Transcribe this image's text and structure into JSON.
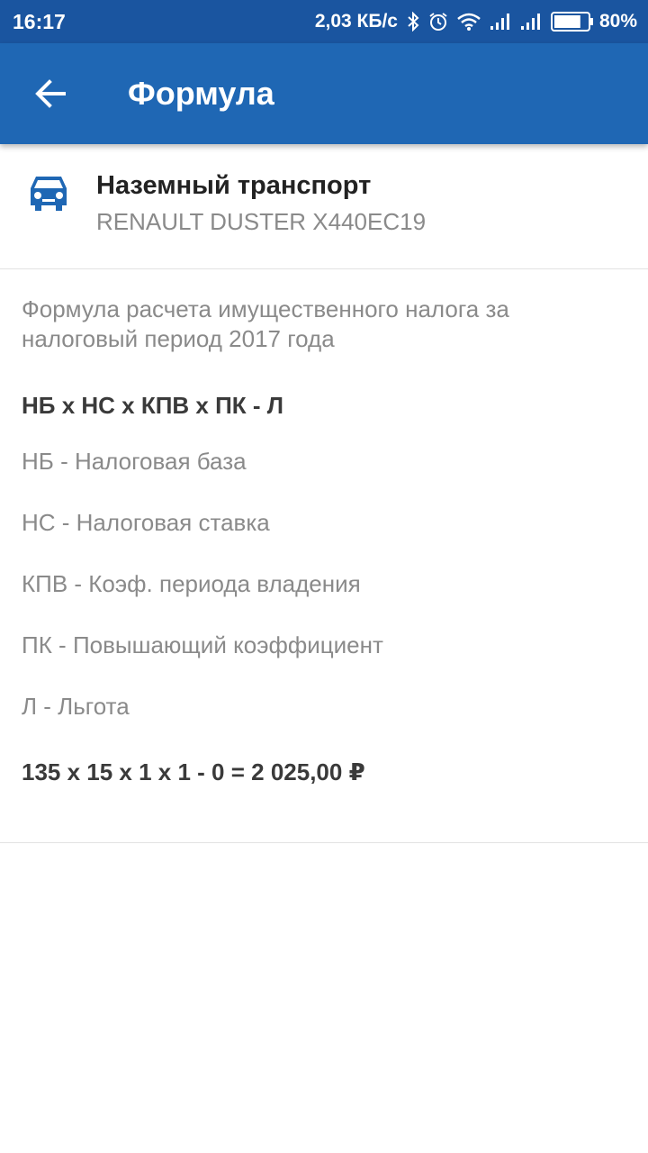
{
  "status_bar": {
    "time": "16:17",
    "net_speed": "2,03 КБ/с",
    "battery": "80%",
    "battery_level": 0.8,
    "icons": [
      "bluetooth-icon",
      "alarm-icon",
      "wifi-icon",
      "signal-icon",
      "signal-icon",
      "battery-icon"
    ]
  },
  "app_bar": {
    "back_icon": "arrow-back-icon",
    "title": "Формула",
    "color": "#1f67b4"
  },
  "vehicle": {
    "icon": "car-icon",
    "icon_color": "#1f67b4",
    "type": "Наземный транспорт",
    "name": "RENAULT DUSTER Х440ЕС19"
  },
  "formula": {
    "description": "Формула расчета имущественного налога за налоговый период 2017 года",
    "expression": "НБ х НС х КПВ х ПК - Л",
    "legend": [
      "НБ - Налоговая база",
      "НС - Налоговая ставка",
      "КПВ - Коэф. периода владения",
      "ПК - Повышающий коэффициент",
      "Л - Льгота"
    ],
    "calculation": "135 х 15 х 1 х 1 - 0 = 2 025,00 ₽"
  }
}
